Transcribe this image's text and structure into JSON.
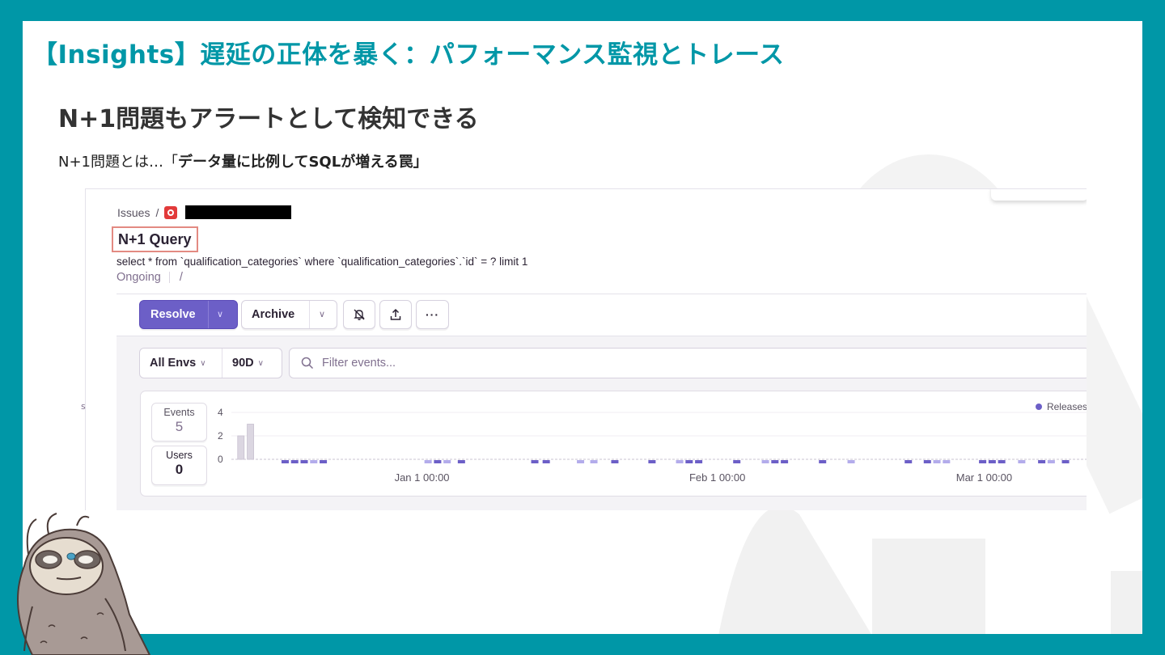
{
  "slide": {
    "title": "【Insights】遅延の正体を暴く：パフォーマンス監視とトレース",
    "subtitle": "N+1問題もアラートとして検知できる",
    "note_prefix": "N+1問題とは…「",
    "note_strong": "データ量に比例してSQLが増える罠」"
  },
  "colors": {
    "teal": "#0097a7",
    "accent": "#6c5fc7",
    "release": "#6c5fc7",
    "release_light": "#b3aceb",
    "highlight_box": "#e38a82"
  },
  "issue": {
    "breadcrumb_root": "Issues",
    "breadcrumb_sep": "/",
    "project_icon": "project-badge-icon",
    "title": "N+1 Query",
    "query": "select * from `qualification_categories` where `qualification_categories`.`id` = ? limit 1",
    "status": "Ongoing",
    "status_sep": "/"
  },
  "toolbar": {
    "resolve_label": "Resolve",
    "archive_label": "Archive",
    "mute_icon": "bell-off-icon",
    "share_icon": "upload-icon",
    "more_label": "···"
  },
  "filters": {
    "env_label": "All Envs",
    "period_label": "90D",
    "search_placeholder": "Filter events..."
  },
  "chart_stats": {
    "events_label": "Events",
    "events_value": "5",
    "users_label": "Users",
    "users_value": "0"
  },
  "chart_data": {
    "type": "bar",
    "yticks": [
      4,
      2,
      0
    ],
    "ylim": [
      0,
      4
    ],
    "xticks": [
      "Jan 1 00:00",
      "Feb 1 00:00",
      "Mar 1 00:00"
    ],
    "xlim_days": [
      -20,
      70
    ],
    "tick_days": [
      0,
      31,
      59
    ],
    "bars": [
      {
        "day": -19,
        "value": 2
      },
      {
        "day": -18,
        "value": 3
      }
    ],
    "legend": "Releases",
    "release_days": [
      -14.4,
      -13.4,
      -12.4,
      -11.4,
      -10.4,
      0.6,
      1.6,
      2.6,
      4.1,
      11.8,
      13.0,
      16.6,
      18.0,
      20.2,
      24.1,
      27.0,
      28.0,
      29.0,
      33.0,
      36.0,
      37.0,
      38.0,
      42.0,
      45.0,
      51.0,
      53.0,
      54.0,
      55.0,
      58.8,
      59.8,
      60.8,
      62.9,
      65.0,
      66.0,
      67.5,
      71.5,
      74.6
    ]
  }
}
